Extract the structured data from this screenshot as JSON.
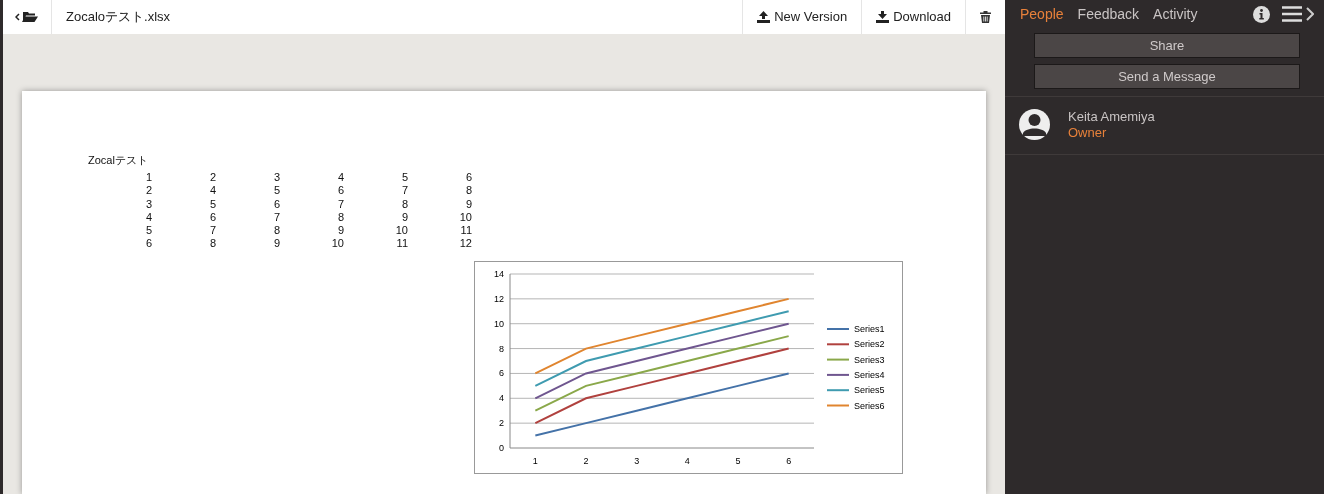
{
  "toolbar": {
    "file_name": "Zocaloテスト.xlsx",
    "buttons": [
      {
        "kind": "upload",
        "label": "New Version"
      },
      {
        "kind": "download",
        "label": "Download"
      },
      {
        "kind": "delete"
      }
    ]
  },
  "sheet": {
    "title": "Zocalテスト",
    "rows": [
      [
        "1",
        "2",
        "3",
        "4",
        "5",
        "6"
      ],
      [
        "2",
        "4",
        "5",
        "6",
        "7",
        "8"
      ],
      [
        "3",
        "5",
        "6",
        "7",
        "8",
        "9"
      ],
      [
        "4",
        "6",
        "7",
        "8",
        "9",
        "10"
      ],
      [
        "5",
        "7",
        "8",
        "9",
        "10",
        "11"
      ],
      [
        "6",
        "8",
        "9",
        "10",
        "11",
        "12"
      ]
    ],
    "chart_data": {
      "type": "line",
      "grid": true,
      "legend": true,
      "categories": [
        "1",
        "2",
        "3",
        "4",
        "5",
        "6"
      ],
      "ylim": [
        0,
        14
      ],
      "yticks": [
        0,
        2,
        4,
        6,
        8,
        10,
        12,
        14
      ],
      "series": [
        {
          "name": "Series1",
          "color": "#4472a8",
          "values": [
            1,
            2,
            3,
            4,
            5,
            6
          ]
        },
        {
          "name": "Series2",
          "color": "#b0413e",
          "values": [
            2,
            4,
            5,
            6,
            7,
            8
          ]
        },
        {
          "name": "Series3",
          "color": "#8aa84a",
          "values": [
            3,
            5,
            6,
            7,
            8,
            9
          ]
        },
        {
          "name": "Series4",
          "color": "#6f568f",
          "values": [
            4,
            6,
            7,
            8,
            9,
            10
          ]
        },
        {
          "name": "Series5",
          "color": "#3f9bb0",
          "values": [
            5,
            7,
            8,
            9,
            10,
            11
          ]
        },
        {
          "name": "Series6",
          "color": "#e0852f",
          "values": [
            6,
            8,
            9,
            10,
            11,
            12
          ]
        }
      ]
    }
  },
  "sidebar": {
    "tabs": [
      {
        "label": "People",
        "selected": true
      },
      {
        "label": "Feedback",
        "selected": false
      },
      {
        "label": "Activity",
        "selected": false
      }
    ],
    "buttons": [
      "Share",
      "Send a Message"
    ],
    "people": [
      {
        "name": "Keita Amemiya",
        "role": "Owner"
      }
    ]
  }
}
